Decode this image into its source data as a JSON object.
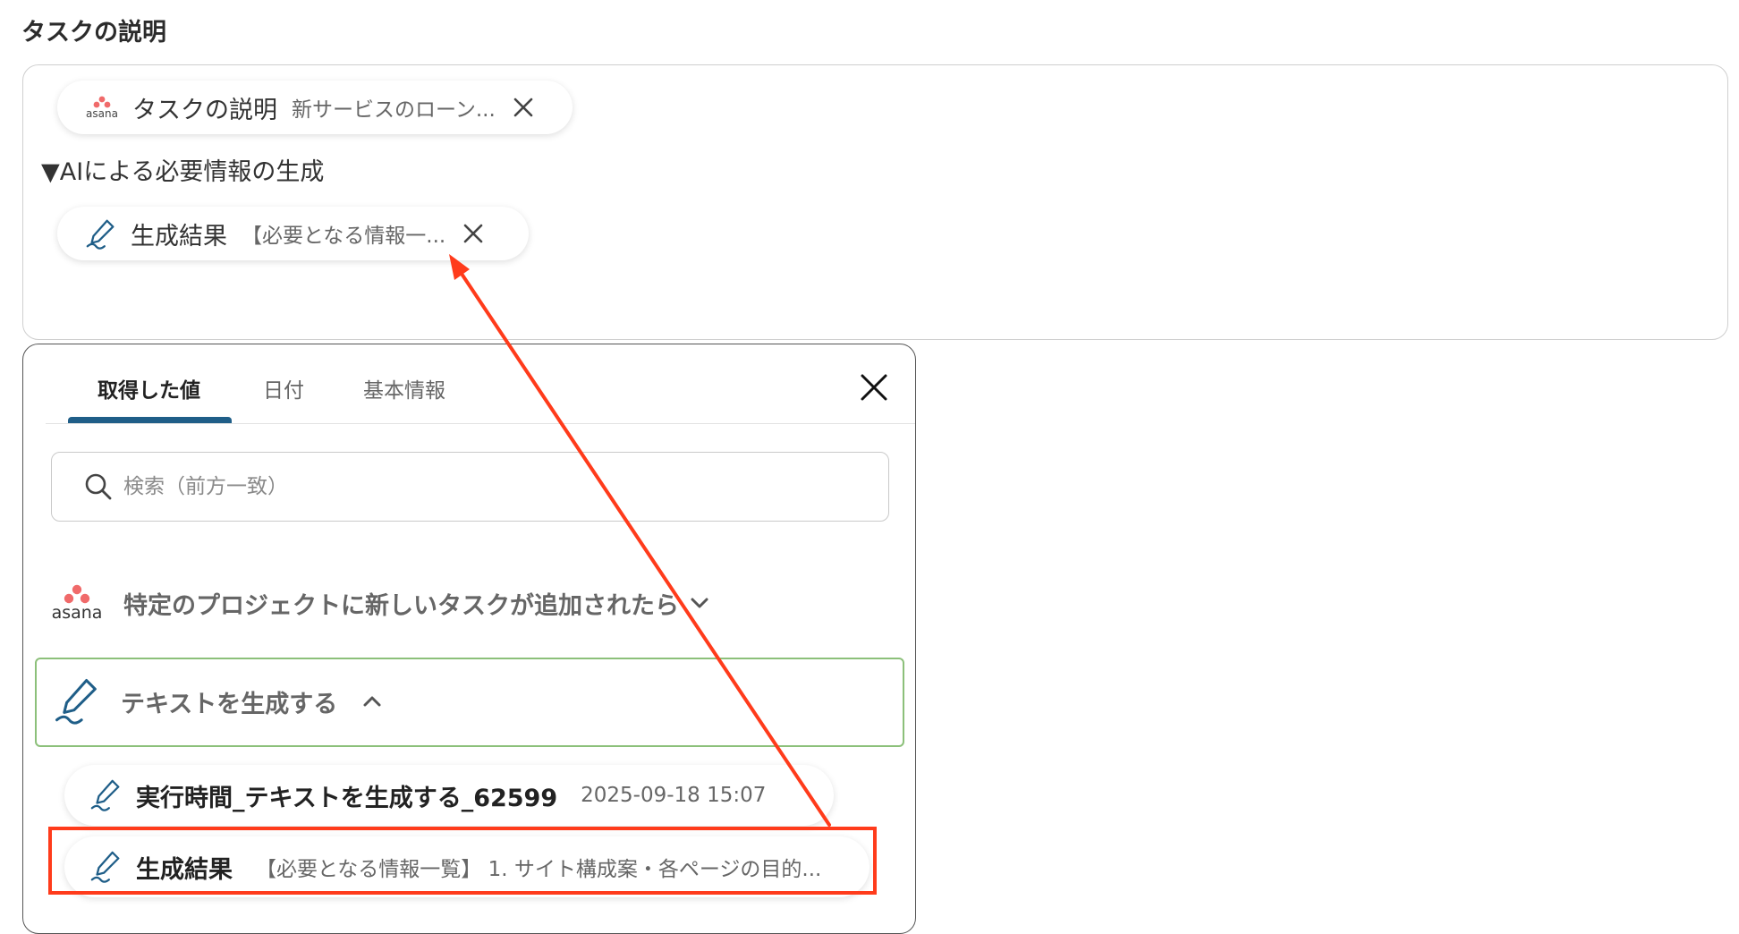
{
  "section": {
    "title": "タスクの説明"
  },
  "description_box": {
    "asana_chip": {
      "logo_text": "asana",
      "label": "タスクの説明",
      "value": "新サービスのローン..."
    },
    "heading": "▼AIによる必要情報の生成",
    "ai_chip": {
      "label": "生成結果",
      "value": "【必要となる情報一..."
    }
  },
  "panel": {
    "tabs": [
      {
        "label": "取得した値",
        "active": true
      },
      {
        "label": "日付",
        "active": false
      },
      {
        "label": "基本情報",
        "active": false
      }
    ],
    "search": {
      "placeholder": "検索（前方一致）",
      "value": ""
    },
    "groups": [
      {
        "logo_text": "asana",
        "label": "特定のプロジェクトに新しいタスクが追加されたら",
        "icon": "chevron-down-icon",
        "expanded": false
      },
      {
        "label": "テキストを生成する",
        "icon": "chevron-up-icon",
        "expanded": true,
        "selected": true
      }
    ],
    "items": [
      {
        "name": "実行時間_テキストを生成する_62599",
        "value": "2025-09-18 15:07"
      },
      {
        "name": "生成結果",
        "value": "【必要となる情報一覧】 1. サイト構成案・各ページの目的..."
      }
    ]
  },
  "colors": {
    "accent_tab": "#1f5e88",
    "selected_border": "#8cc07a",
    "highlight": "#ff3b1b",
    "asana_logo": "#f06a6a",
    "ai_icon": "#1f5e88"
  }
}
